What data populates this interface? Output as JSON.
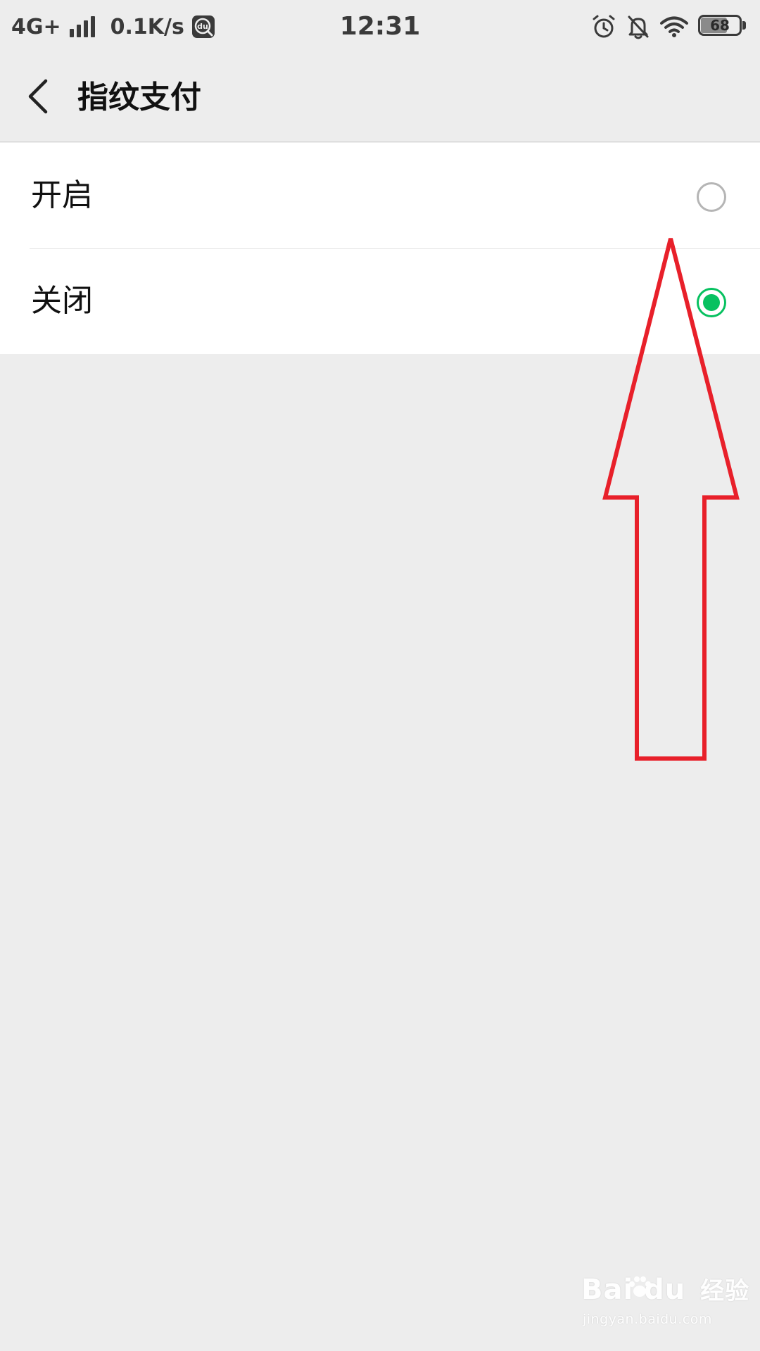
{
  "status_bar": {
    "network": "4G+",
    "speed": "0.1K/s",
    "du_badge": "du",
    "time": "12:31",
    "battery_level": "68",
    "battery_fraction": 0.68,
    "icons": [
      "signal-icon",
      "baidu-du-icon",
      "alarm-icon",
      "bell-off-icon",
      "wifi-icon",
      "battery-icon"
    ]
  },
  "nav": {
    "title": "指纹支付",
    "back_icon": "back-chevron-icon"
  },
  "options": [
    {
      "label": "开启",
      "selected": false
    },
    {
      "label": "关闭",
      "selected": true
    }
  ],
  "colors": {
    "background": "#ededed",
    "card": "#ffffff",
    "accent_green": "#07c160",
    "radio_border": "#b5b5b5",
    "annotation_red": "#e8202a"
  },
  "watermark": {
    "logo": "Bai  du",
    "logo_suffix": "经验",
    "url": "jingyan.baidu.com"
  }
}
